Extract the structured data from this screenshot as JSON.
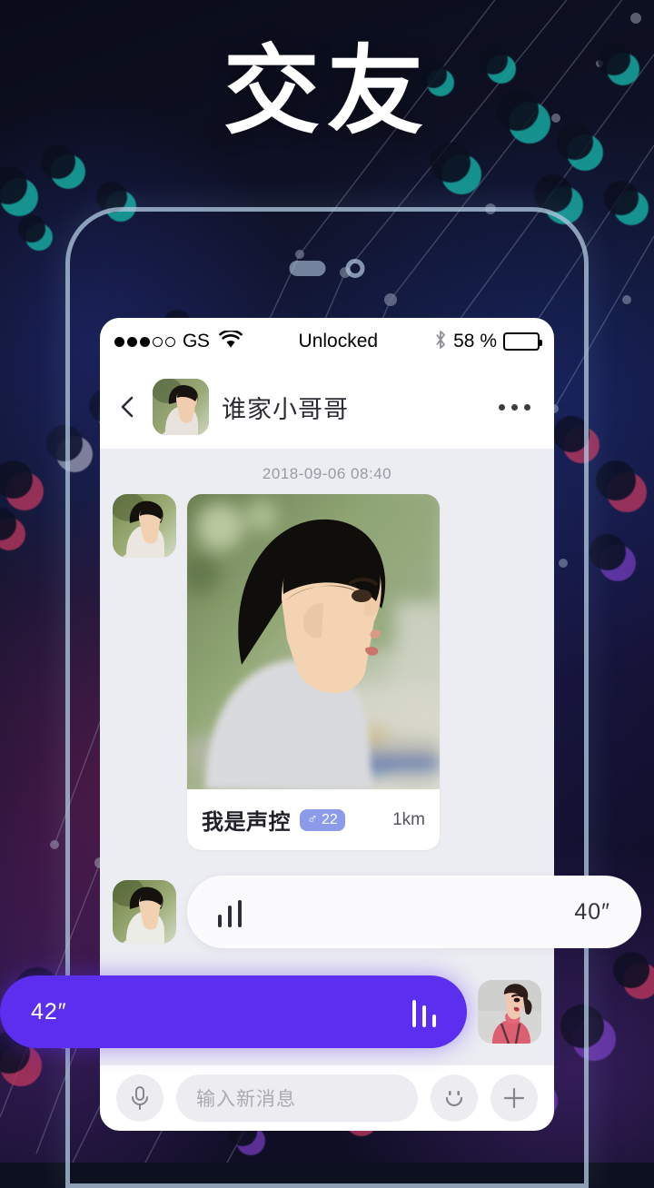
{
  "hero": {
    "title": "交友"
  },
  "statusbar": {
    "signal_dots_filled": 3,
    "signal_dots_total": 5,
    "carrier": "GS",
    "wifi_icon": "wifi-icon",
    "center_text": "Unlocked",
    "bluetooth_icon": "bluetooth-icon",
    "battery_text": "58 %",
    "battery_percent": 58
  },
  "navbar": {
    "back_icon": "chevron-left-icon",
    "avatar": "contact-avatar",
    "title": "谁家小哥哥",
    "more_icon": "more-horizontal-icon"
  },
  "chat": {
    "timestamp": "2018-09-06  08:40",
    "card": {
      "photo": "profile-photo-man",
      "name": "我是声控",
      "gender_symbol": "♂",
      "age": "22",
      "badge_color": "#8c9aea",
      "distance": "1km"
    },
    "voice_incoming": {
      "duration": "40″",
      "waveform_bars": [
        14,
        24,
        30
      ],
      "bubble_color": "#fbfbfd"
    },
    "voice_outgoing": {
      "duration": "42″",
      "waveform_bars": [
        30,
        24,
        14
      ],
      "bubble_color": "#5b2ef0"
    },
    "avatar_self": "self-avatar-woman"
  },
  "inputbar": {
    "mic_icon": "microphone-icon",
    "placeholder": "输入新消息",
    "emoji_icon": "smiley-icon",
    "plus_icon": "plus-icon"
  },
  "device": {
    "speaker_icon": "speaker-slot",
    "camera_icon": "front-camera"
  }
}
